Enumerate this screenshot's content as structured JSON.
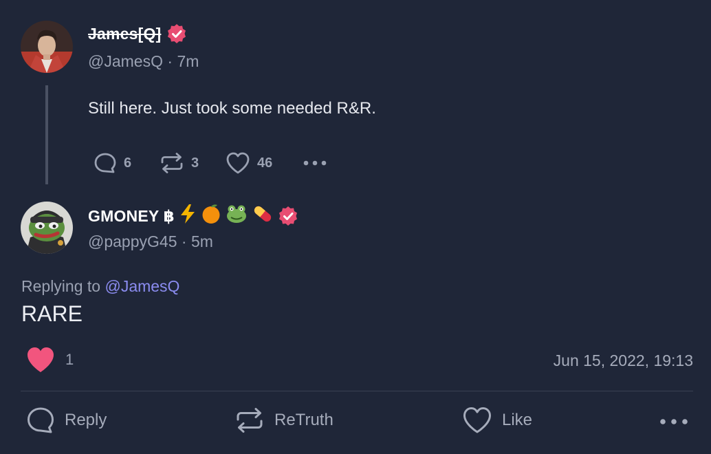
{
  "parent_post": {
    "display_name": "James[Q]",
    "handle": "@JamesQ",
    "time": "7m",
    "text": "Still here. Just took some needed R&R.",
    "replies": "6",
    "retruths": "3",
    "likes": "46"
  },
  "reply_post": {
    "display_name": "GMONEY ฿",
    "name_emojis": [
      "⚡",
      "🍊",
      "🐸",
      "💊"
    ],
    "handle": "@pappyG45",
    "time": "5m",
    "replying_to_label": "Replying to",
    "replying_to_handle": "@JamesQ",
    "text": "RARE",
    "likes": "1",
    "timestamp": "Jun 15, 2022, 19:13"
  },
  "action_bar": {
    "reply_label": "Reply",
    "retruth_label": "ReTruth",
    "like_label": "Like"
  },
  "colors": {
    "background": "#1f2638",
    "verified": "#e84d72",
    "link": "#8b8cf0",
    "heart": "#f2557e"
  }
}
